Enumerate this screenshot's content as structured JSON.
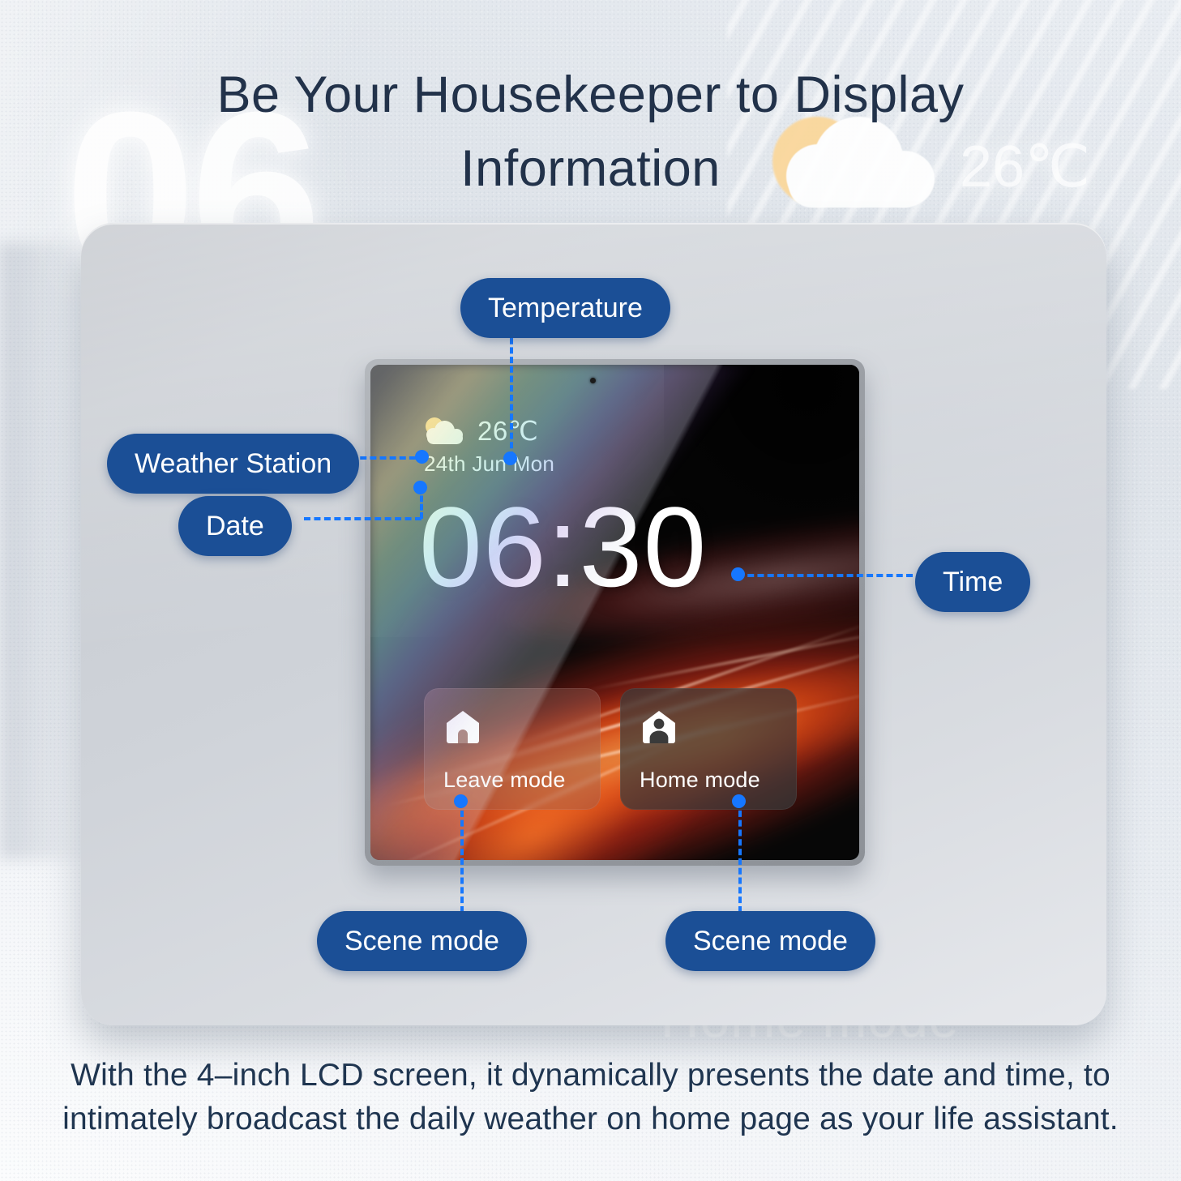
{
  "heading": {
    "line1": "Be Your Housekeeper to Display",
    "line2": "Information"
  },
  "background": {
    "watermark_number": "06",
    "watermark_temperature": "26℃",
    "watermark_weather_icon": "sun-behind-cloud-icon",
    "watermark_text": "Home mode"
  },
  "device": {
    "screen": {
      "weather_icon": "sun-behind-cloud-icon",
      "temperature": "26℃",
      "date": "24th Jun  Mon",
      "time": "06:30",
      "modes": [
        {
          "icon": "house-icon",
          "label": "Leave mode"
        },
        {
          "icon": "house-person-icon",
          "label": "Home mode"
        }
      ]
    }
  },
  "callouts": [
    {
      "id": "temperature",
      "label": "Temperature"
    },
    {
      "id": "weather",
      "label": "Weather Station"
    },
    {
      "id": "date",
      "label": "Date"
    },
    {
      "id": "time",
      "label": "Time"
    },
    {
      "id": "scene1",
      "label": "Scene mode"
    },
    {
      "id": "scene2",
      "label": "Scene mode"
    }
  ],
  "caption": {
    "line1": "With the 4–inch LCD screen, it dynamically presents the date and time, to",
    "line2": "intimately broadcast the daily weather on home page as your life assistant."
  },
  "colors": {
    "badge_blue": "#1b4f96",
    "leader_blue": "#1677ff",
    "heading_navy": "#22324a",
    "caption_navy": "#1f3550",
    "plate_gray": "#cfd3d9",
    "screen_black": "#070707"
  }
}
